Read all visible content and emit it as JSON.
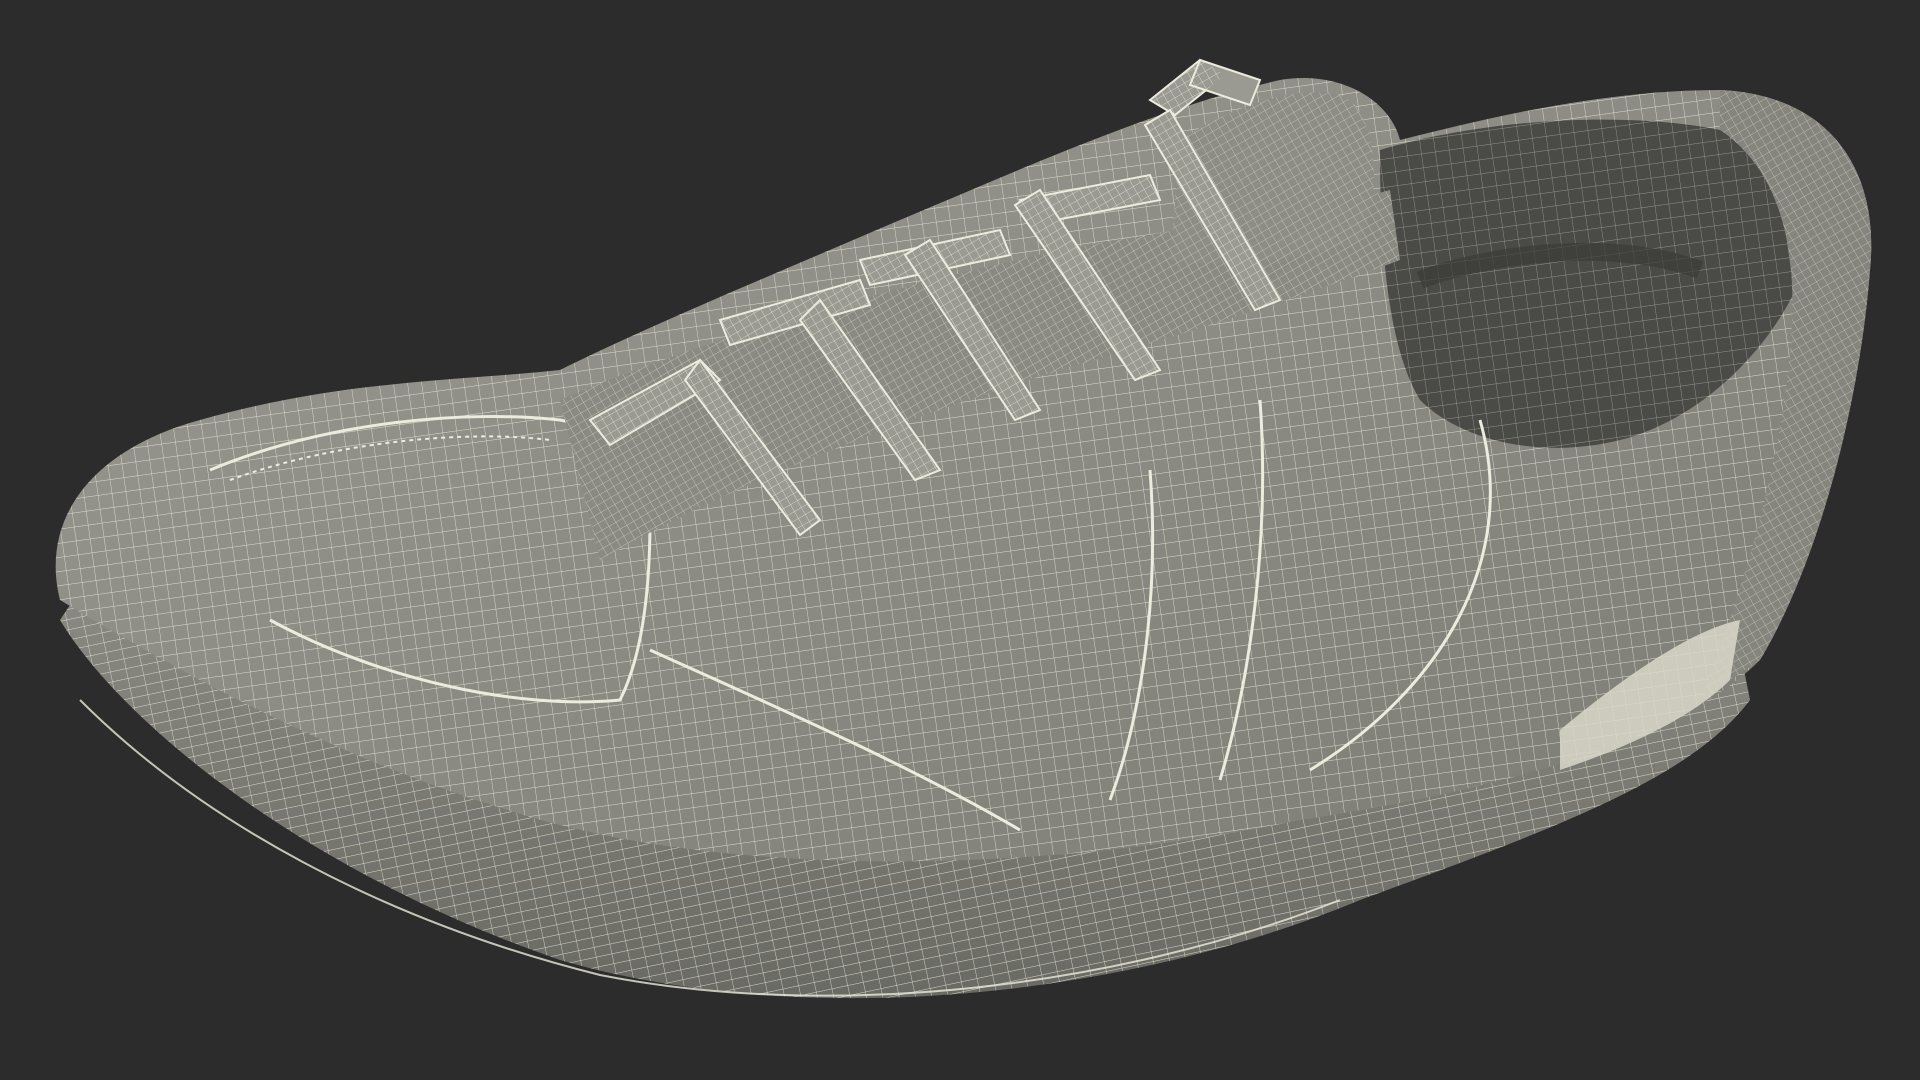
{
  "scene": {
    "background_color": "#2c2c2c",
    "model": {
      "subject": "sneaker-wireframe",
      "shade_color": "#8f8f87",
      "shade_dark_color": "#5e5e58",
      "interior_color": "#4a4a46",
      "wire_color": "#ecebdd",
      "highlight_color": "#d9d8c9"
    }
  }
}
